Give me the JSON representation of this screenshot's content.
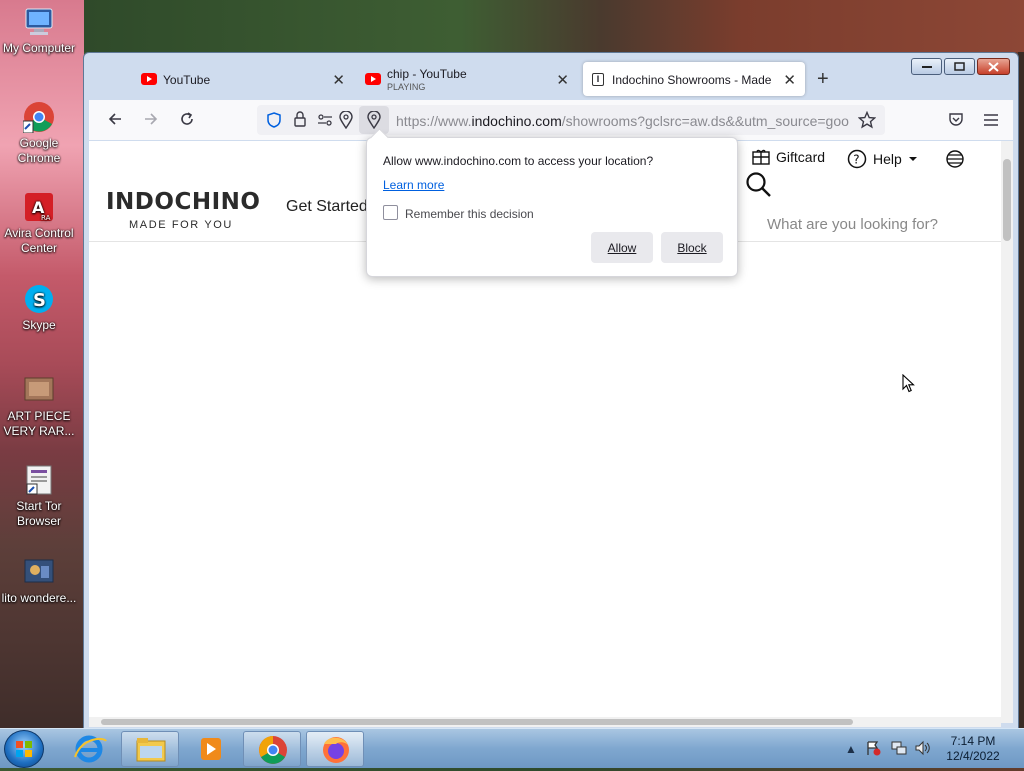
{
  "desktop": {
    "icons": [
      {
        "label": "My Computer"
      },
      {
        "label": "Google Chrome"
      },
      {
        "label": "Avira Control Center"
      },
      {
        "label": "Skype"
      },
      {
        "label": "ART PIECE VERY RAR..."
      },
      {
        "label": "Start Tor Browser"
      },
      {
        "label": "lito wondere..."
      }
    ]
  },
  "browser": {
    "tabs": [
      {
        "title": "YouTube",
        "subtitle": ""
      },
      {
        "title": "chip - YouTube",
        "subtitle": "PLAYING"
      },
      {
        "title": "Indochino Showrooms - Made f"
      }
    ],
    "url": {
      "prefix": "https://www.",
      "domain": "indochino.com",
      "path": "/showrooms?gclsrc=aw.ds&&utm_source=goo"
    }
  },
  "page": {
    "logo": "INDOCHINO",
    "logo_sub": "MADE FOR YOU",
    "nav_get_started": "Get Started",
    "giftcard": "Giftcard",
    "help": "Help",
    "search_placeholder": "What are you looking for?"
  },
  "permission_popup": {
    "question": "Allow www.indochino.com to access your location?",
    "learn_more": "Learn more",
    "remember_label": "Remember this decision",
    "allow_label": "Allow",
    "block_label": "Block"
  },
  "taskbar": {
    "time": "7:14 PM",
    "date": "12/4/2022"
  },
  "colors": {
    "accent": "#0060df",
    "youtube_red": "#ff0000"
  }
}
